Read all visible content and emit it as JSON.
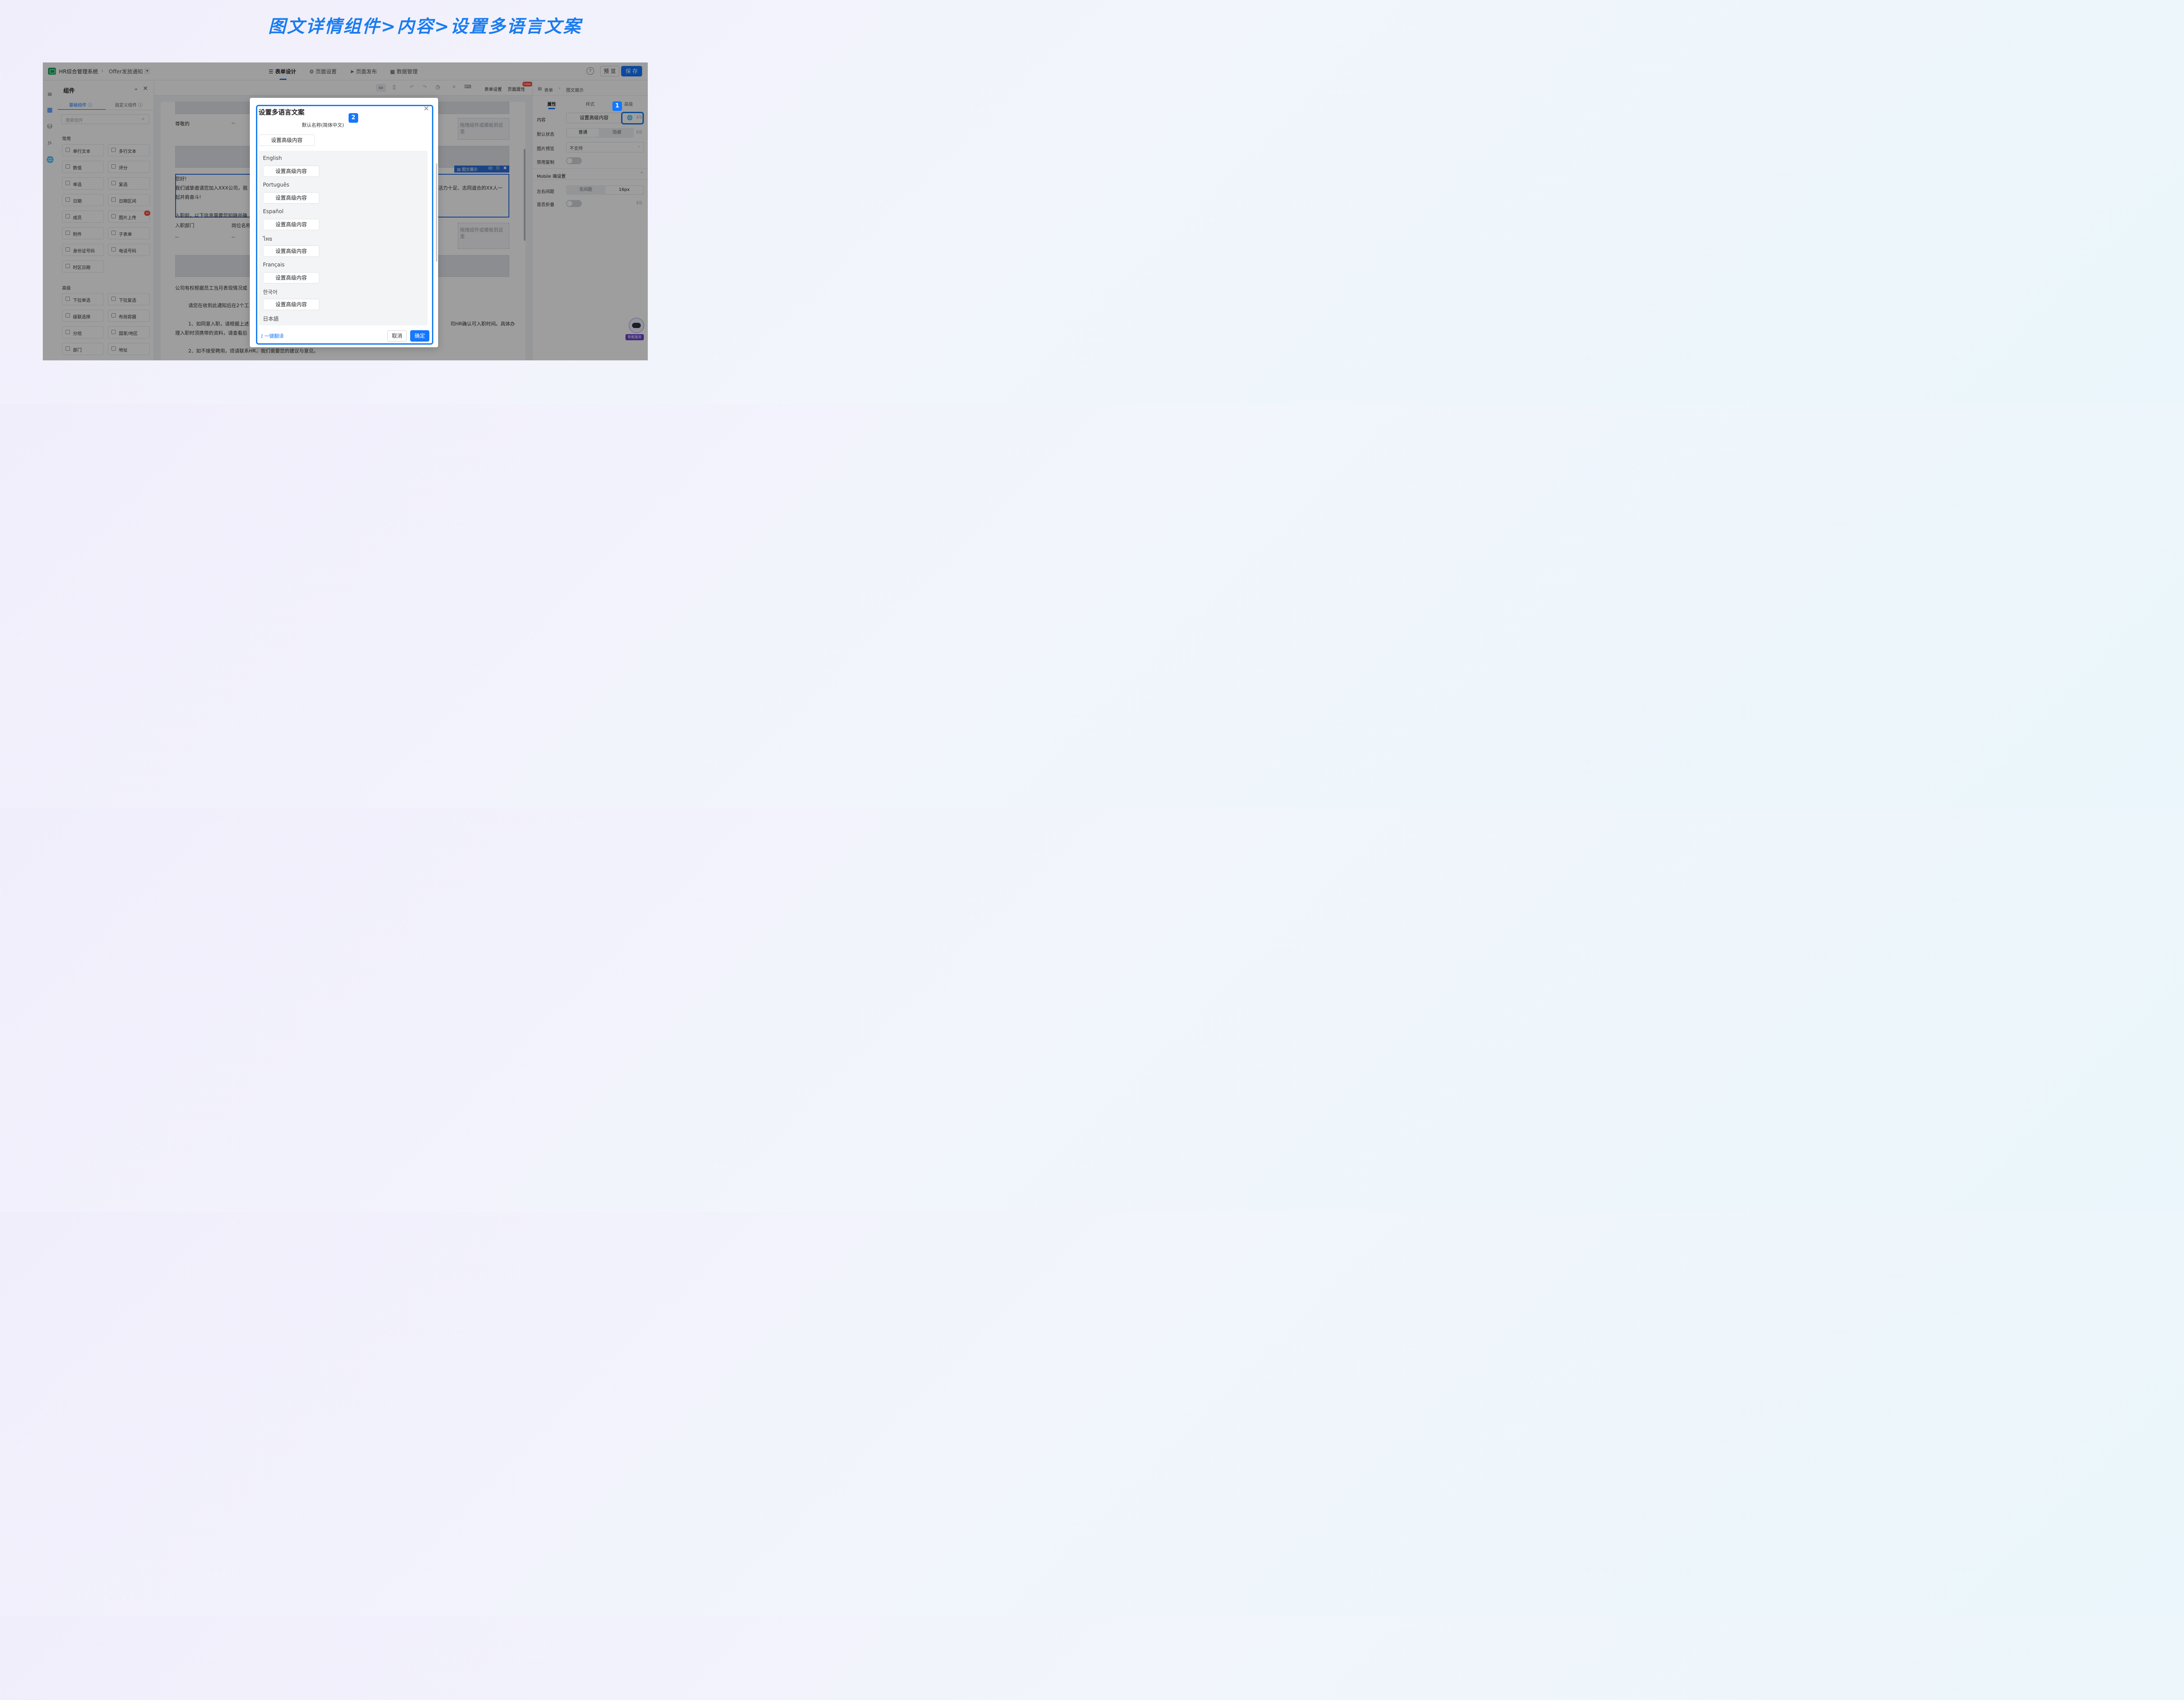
{
  "banner": {
    "title": "图文详情组件>内容>设置多语言文案"
  },
  "app": {
    "name": "HR综合管理系统",
    "page": "Offer发放通知",
    "tabs": [
      "表单设计",
      "页面设置",
      "页面发布",
      "数据管理"
    ],
    "help": "?",
    "preview_label": "预 览",
    "save_label": "保 存",
    "accent": "#1677ff"
  },
  "components_panel": {
    "title": "组件",
    "tabs": [
      "基础组件",
      "自定义组件"
    ],
    "search_placeholder": "搜索组件",
    "common_label": "常用",
    "common_items": [
      "单行文本",
      "多行文本",
      "数值",
      "评分",
      "单选",
      "复选",
      "日期",
      "日期区间",
      "成员",
      "图片上传",
      "附件",
      "子表单",
      "身份证号码",
      "电话号码",
      "时区日期"
    ],
    "ai_badge": "AI",
    "advanced_label": "高级",
    "advanced_items": [
      "下拉单选",
      "下拉复选",
      "级联选择",
      "布局容器",
      "分组",
      "国家/地区",
      "部门",
      "地址"
    ]
  },
  "toolbar": {
    "form_settings": "表单设置",
    "page_props": "页面属性",
    "new_badge": "new",
    "breadcrumb": [
      "表单",
      "图文展示"
    ]
  },
  "canvas": {
    "greeting_label": "尊敬的",
    "dash": "--",
    "drop_hint": "拖拽组件或模板到这里",
    "selected_tag": "图文展示",
    "line1": "您好!",
    "line2a": "我们诚挚邀请您加入XXX公司，我",
    "line2b": "活力十足、志同道合的XX人一",
    "line3": "起并肩奋斗!",
    "line4": "入职前，以下信息需要您知晓并确",
    "col1": "入职部门",
    "col2": "岗位名称",
    "para1": "公司有权根据员工当月表现情况或",
    "para2": "请您在收到此通知后在2个工",
    "para3a": "1、如同意入职，请根据上述",
    "para3b": "司HR确认可入职时间。具体办",
    "para4": "理入职时须携带的资料，请查看后",
    "para5": "2、如不接受聘用，烦请联系HR，我们需要您的建议与意见。"
  },
  "right_panel": {
    "tabs": [
      "属性",
      "样式",
      "高级"
    ],
    "content_label": "内容",
    "content_btn": "设置高级内容",
    "default_state_label": "默认状态",
    "state_options": [
      "普通",
      "隐藏"
    ],
    "image_preview_label": "图片预览",
    "image_preview_value": "不支持",
    "disable_copy_label": "禁用复制",
    "mobile_section": "Mobile 端设置",
    "margin_label": "左右间距",
    "margin_options": [
      "无间距",
      "16px"
    ],
    "collapse_label": "是否折叠",
    "expr_icon": "{/}",
    "assistant_label": "智能服务"
  },
  "modal": {
    "title": "设置多语言文案",
    "default_name_label": "默认名称(简体中文)",
    "default_btn": "设置高级内容",
    "languages": [
      {
        "name": "English",
        "btn": "设置高级内容"
      },
      {
        "name": "Português",
        "btn": "设置高级内容"
      },
      {
        "name": "Español",
        "btn": "设置高级内容"
      },
      {
        "name": "ไทย",
        "btn": "设置高级内容"
      },
      {
        "name": "Français",
        "btn": "设置高级内容"
      },
      {
        "name": "한국어",
        "btn": "设置高级内容"
      },
      {
        "name": "日本語",
        "btn": "设置高级内容"
      }
    ],
    "translate_label": "一键翻译",
    "cancel_label": "取消",
    "ok_label": "确定"
  },
  "annotations": {
    "badge1": "1",
    "badge2": "2"
  }
}
